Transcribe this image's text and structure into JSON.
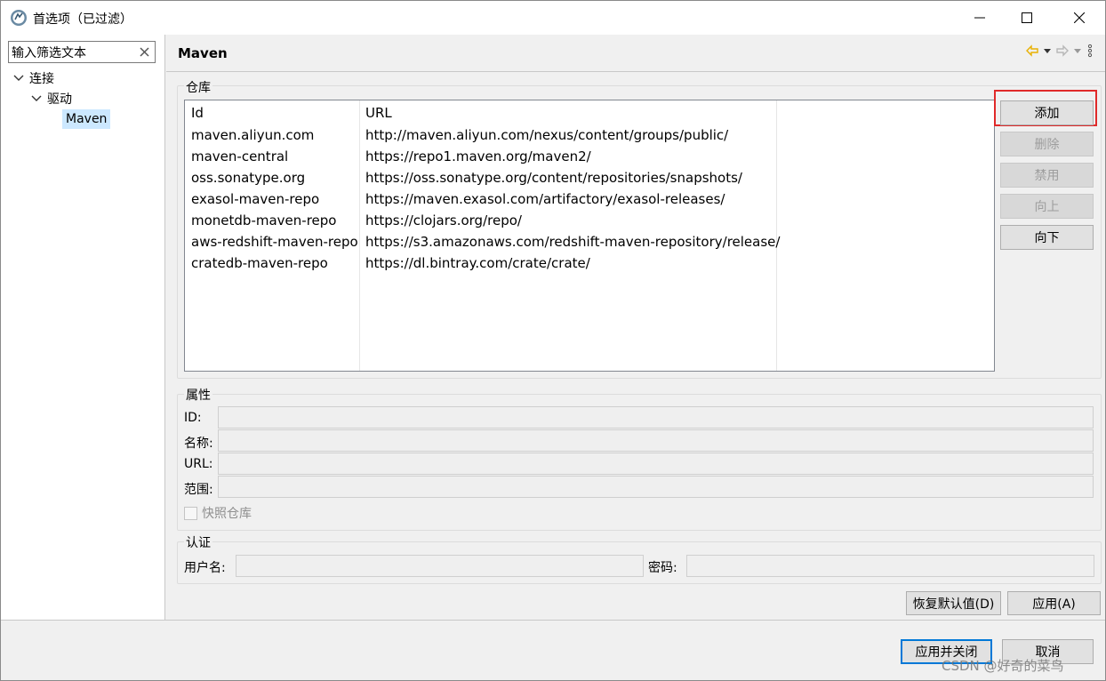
{
  "window": {
    "title": "首选项（已过滤）",
    "minimize_icon": "minimize-icon",
    "maximize_icon": "maximize-icon",
    "close_icon": "close-icon"
  },
  "sidebar": {
    "filter_value": "输入筛选文本",
    "tree": [
      {
        "label": "连接",
        "expanded": true
      },
      {
        "label": "驱动",
        "expanded": true
      },
      {
        "label": "Maven",
        "selected": true
      }
    ]
  },
  "page": {
    "title": "Maven"
  },
  "repositories": {
    "group_label": "仓库",
    "columns": [
      "Id",
      "URL"
    ],
    "rows": [
      {
        "id": "maven.aliyun.com",
        "url": "http://maven.aliyun.com/nexus/content/groups/public/"
      },
      {
        "id": "maven-central",
        "url": "https://repo1.maven.org/maven2/"
      },
      {
        "id": "oss.sonatype.org",
        "url": "https://oss.sonatype.org/content/repositories/snapshots/"
      },
      {
        "id": "exasol-maven-repo",
        "url": "https://maven.exasol.com/artifactory/exasol-releases/"
      },
      {
        "id": "monetdb-maven-repo",
        "url": "https://clojars.org/repo/"
      },
      {
        "id": "aws-redshift-maven-repo",
        "url": "https://s3.amazonaws.com/redshift-maven-repository/release/"
      },
      {
        "id": "cratedb-maven-repo",
        "url": "https://dl.bintray.com/crate/crate/"
      }
    ],
    "buttons": {
      "add": "添加",
      "delete": "删除",
      "disable": "禁用",
      "up": "向上",
      "down": "向下"
    }
  },
  "properties": {
    "group_label": "属性",
    "id_label": "ID:",
    "name_label": "名称:",
    "url_label": "URL:",
    "scope_label": "范围:",
    "snapshot_label": "快照仓库",
    "snapshot_checked": false
  },
  "auth": {
    "group_label": "认证",
    "username_label": "用户名:",
    "password_label": "密码:"
  },
  "actions": {
    "restore_defaults": "恢复默认值(D)",
    "apply": "应用(A)",
    "apply_close": "应用并关闭",
    "cancel": "取消"
  },
  "watermark": "CSDN @好奇的菜鸟",
  "colors": {
    "highlight": "#e02a2a",
    "selection": "#cce8ff",
    "primary_border": "#0078d7",
    "back_arrow": "#e8b000"
  }
}
